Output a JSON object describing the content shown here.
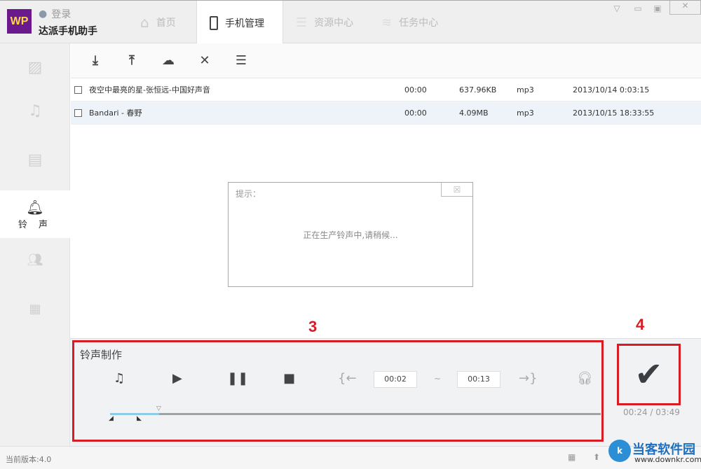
{
  "app": {
    "logo": "WP",
    "login": "登录",
    "name": "达派手机助手"
  },
  "tabs": [
    {
      "label": "首页"
    },
    {
      "label": "手机管理"
    },
    {
      "label": "资源中心"
    },
    {
      "label": "任务中心"
    }
  ],
  "sidebar": {
    "active_label": "铃 声"
  },
  "files": [
    {
      "name": "夜空中最亮的星-张恒远-中国好声音",
      "duration": "00:00",
      "size": "637.96KB",
      "type": "mp3",
      "date": "2013/10/14 0:03:15"
    },
    {
      "name": "Bandari - 春野",
      "duration": "00:00",
      "size": "4.09MB",
      "type": "mp3",
      "date": "2013/10/15 18:33:55"
    }
  ],
  "dialog": {
    "title": "提示：",
    "message": "正在生产铃声中,请稍候..."
  },
  "ringtone": {
    "title": "铃声制作",
    "start": "00:02",
    "sep": "~",
    "end": "00:13",
    "progress": 0.1,
    "elapsed": "00:24 / 03:49"
  },
  "annotations": {
    "a3": "3",
    "a4": "4"
  },
  "status": {
    "version": "当前版本:4.0",
    "watermark": "当客软件园",
    "watermark_url": "www.downkr.com"
  }
}
